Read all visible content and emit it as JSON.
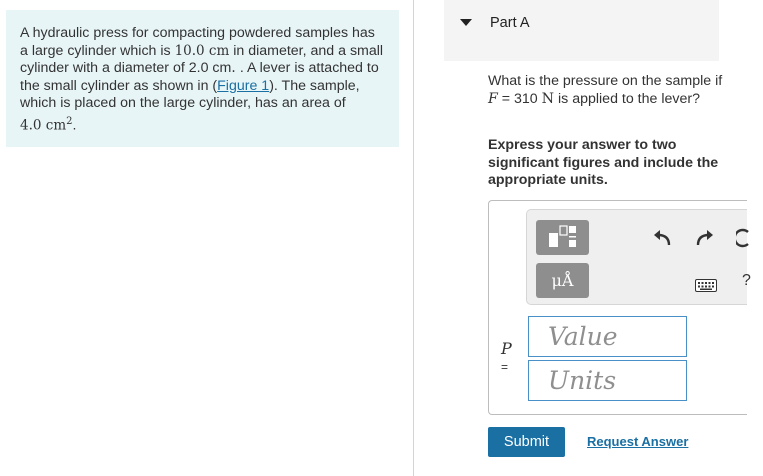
{
  "problem": {
    "intro": "A hydraulic press for compacting powdered samples has a large cylinder which is ",
    "large_diameter": "10.0 cm",
    "mid1": " in diameter, and a small cylinder with a diameter of ",
    "small_diameter": "2.0 cm",
    "mid2": ". A lever is attached to the small cylinder as shown in (",
    "figure_link": "Figure 1",
    "mid3": "). The sample, which is placed on the large cylinder, has an area of",
    "area_value": "4.0 cm",
    "area_exp": "2",
    "end": "."
  },
  "part": {
    "title": "Part A",
    "expanded": true
  },
  "question": {
    "prefix": "What is the pressure on the sample if ",
    "var": "F",
    "eq": " = 310 ",
    "unit": "N",
    "suffix": " is applied to the lever?"
  },
  "instructions": "Express your answer to two significant figures and include the appropriate units.",
  "toolbar": {
    "units_label": "μÅ",
    "icons": [
      "templates-icon",
      "units-icon",
      "undo-icon",
      "redo-icon",
      "reset-icon",
      "keyboard-icon",
      "help-icon"
    ]
  },
  "answer": {
    "variable": "P",
    "equals": "=",
    "value_placeholder": "Value",
    "units_placeholder": "Units"
  },
  "actions": {
    "submit": "Submit",
    "request": "Request Answer"
  },
  "colors": {
    "problem_bg": "#e8f5f7",
    "accent": "#1a6fa3",
    "field_border": "#4a90c8",
    "toolbar_bg": "#efefef"
  }
}
